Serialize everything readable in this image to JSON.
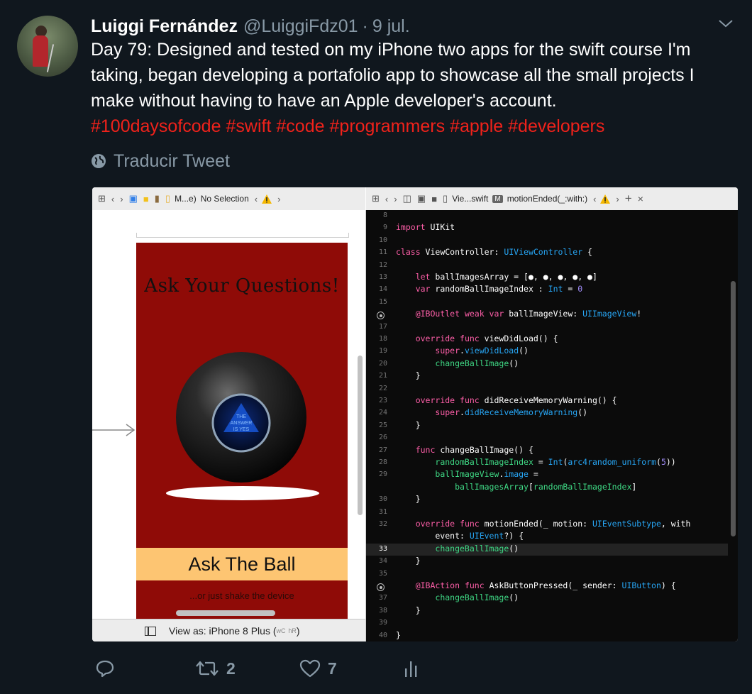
{
  "tweet": {
    "name": "Luiggi Fernández",
    "handle": "@LuiggiFdz01",
    "separator": "·",
    "date": "9 jul.",
    "text": "Day 79: Designed and tested on my iPhone two apps for the swift course I'm taking, began developing a portafolio app to showcase all the small projects I make without having to have an Apple developer's account.",
    "hashtags": [
      "#100daysofcode",
      "#swift",
      "#code",
      "#programmers",
      "#apple",
      "#developers"
    ],
    "translate_label": "Traducir Tweet"
  },
  "xcode": {
    "left_toolbar": {
      "breadcrumb": "M...e)",
      "selection": "No Selection"
    },
    "right_toolbar": {
      "file": "Vie...swift",
      "symbol_badge": "M",
      "method": "motionEnded(_:with:)"
    },
    "bottom_bar": {
      "label": "View as: iPhone 8 Plus (",
      "size_w": "wC",
      "size_h": "hR",
      "label_end": ")"
    },
    "app": {
      "title": "Ask Your Questions!",
      "ball_text": [
        "THE",
        "ANSWER",
        "IS YES"
      ],
      "button": "Ask The Ball",
      "hint": "...or just shake the device"
    },
    "code": [
      {
        "n": "8",
        "t": [
          [
            "",
            ""
          ]
        ]
      },
      {
        "n": "9",
        "t": [
          [
            "kw",
            "import"
          ],
          [
            "",
            " UIKit"
          ]
        ]
      },
      {
        "n": "10",
        "t": [
          [
            "",
            ""
          ]
        ]
      },
      {
        "n": "11",
        "t": [
          [
            "kw",
            "class"
          ],
          [
            "",
            " ViewController: "
          ],
          [
            "ty",
            "UIViewController"
          ],
          [
            "",
            " {"
          ]
        ]
      },
      {
        "n": "12",
        "t": [
          [
            "",
            ""
          ]
        ]
      },
      {
        "n": "13",
        "t": [
          [
            "",
            "    "
          ],
          [
            "kw",
            "let"
          ],
          [
            "",
            " ballImagesArray = [●, ●, ●, ●, ●]"
          ]
        ]
      },
      {
        "n": "14",
        "t": [
          [
            "",
            "    "
          ],
          [
            "kw",
            "var"
          ],
          [
            "",
            " randomBallImageIndex : "
          ],
          [
            "ty",
            "Int"
          ],
          [
            "",
            " = "
          ],
          [
            "num",
            "0"
          ]
        ]
      },
      {
        "n": "15",
        "t": [
          [
            "",
            ""
          ]
        ]
      },
      {
        "n": "",
        "bp": true,
        "t": [
          [
            "",
            "    "
          ],
          [
            "kw",
            "@IBOutlet weak var"
          ],
          [
            "",
            " ballImageView: "
          ],
          [
            "ty",
            "UIImageView"
          ],
          [
            "",
            "!"
          ]
        ]
      },
      {
        "n": "17",
        "t": [
          [
            "",
            ""
          ]
        ]
      },
      {
        "n": "18",
        "t": [
          [
            "",
            "    "
          ],
          [
            "kw",
            "override func"
          ],
          [
            "",
            " viewDidLoad() {"
          ]
        ]
      },
      {
        "n": "19",
        "t": [
          [
            "",
            "        "
          ],
          [
            "kw",
            "super"
          ],
          [
            "",
            "."
          ],
          [
            "ty",
            "viewDidLoad"
          ],
          [
            "",
            "()"
          ]
        ]
      },
      {
        "n": "20",
        "t": [
          [
            "",
            "        "
          ],
          [
            "fn",
            "changeBallImage"
          ],
          [
            "",
            "()"
          ]
        ]
      },
      {
        "n": "21",
        "t": [
          [
            "",
            "    }"
          ]
        ]
      },
      {
        "n": "22",
        "t": [
          [
            "",
            ""
          ]
        ]
      },
      {
        "n": "23",
        "t": [
          [
            "",
            "    "
          ],
          [
            "kw",
            "override func"
          ],
          [
            "",
            " didReceiveMemoryWarning() {"
          ]
        ]
      },
      {
        "n": "24",
        "t": [
          [
            "",
            "        "
          ],
          [
            "kw",
            "super"
          ],
          [
            "",
            "."
          ],
          [
            "ty",
            "didReceiveMemoryWarning"
          ],
          [
            "",
            "()"
          ]
        ]
      },
      {
        "n": "25",
        "t": [
          [
            "",
            "    }"
          ]
        ]
      },
      {
        "n": "26",
        "t": [
          [
            "",
            ""
          ]
        ]
      },
      {
        "n": "27",
        "t": [
          [
            "",
            "    "
          ],
          [
            "kw",
            "func"
          ],
          [
            "",
            " changeBallImage() {"
          ]
        ]
      },
      {
        "n": "28",
        "t": [
          [
            "",
            "        "
          ],
          [
            "fn",
            "randomBallImageIndex"
          ],
          [
            "",
            " = "
          ],
          [
            "ty",
            "Int"
          ],
          [
            "",
            "("
          ],
          [
            "ty",
            "arc4random_uniform"
          ],
          [
            "",
            "("
          ],
          [
            "num",
            "5"
          ],
          [
            "",
            "))"
          ]
        ]
      },
      {
        "n": "29",
        "t": [
          [
            "",
            "        "
          ],
          [
            "fn",
            "ballImageView"
          ],
          [
            "",
            "."
          ],
          [
            "ty",
            "image"
          ],
          [
            "",
            " ="
          ]
        ]
      },
      {
        "n": "",
        "t": [
          [
            "",
            "            "
          ],
          [
            "fn",
            "ballImagesArray"
          ],
          [
            "",
            "["
          ],
          [
            "fn",
            "randomBallImageIndex"
          ],
          [
            "",
            "]"
          ]
        ]
      },
      {
        "n": "30",
        "t": [
          [
            "",
            "    }"
          ]
        ]
      },
      {
        "n": "31",
        "t": [
          [
            "",
            ""
          ]
        ]
      },
      {
        "n": "32",
        "t": [
          [
            "",
            "    "
          ],
          [
            "kw",
            "override func"
          ],
          [
            "",
            " motionEnded(_ motion: "
          ],
          [
            "ty",
            "UIEventSubtype"
          ],
          [
            "",
            ", with"
          ]
        ]
      },
      {
        "n": "",
        "t": [
          [
            "",
            "        event: "
          ],
          [
            "ty",
            "UIEvent"
          ],
          [
            "",
            "?) {"
          ]
        ]
      },
      {
        "n": "33",
        "hl": true,
        "t": [
          [
            "",
            "        "
          ],
          [
            "fn",
            "changeBallImage"
          ],
          [
            "",
            "()"
          ]
        ]
      },
      {
        "n": "34",
        "t": [
          [
            "",
            "    }"
          ]
        ]
      },
      {
        "n": "35",
        "t": [
          [
            "",
            ""
          ]
        ]
      },
      {
        "n": "",
        "bp": true,
        "t": [
          [
            "",
            "    "
          ],
          [
            "kw",
            "@IBAction func"
          ],
          [
            "",
            " AskButtonPressed(_ sender: "
          ],
          [
            "ty",
            "UIButton"
          ],
          [
            "",
            ") {"
          ]
        ]
      },
      {
        "n": "37",
        "t": [
          [
            "",
            "        "
          ],
          [
            "fn",
            "changeBallImage"
          ],
          [
            "",
            "()"
          ]
        ]
      },
      {
        "n": "38",
        "t": [
          [
            "",
            "    }"
          ]
        ]
      },
      {
        "n": "39",
        "t": [
          [
            "",
            ""
          ]
        ]
      },
      {
        "n": "40",
        "t": [
          [
            "",
            "}"
          ]
        ]
      }
    ]
  },
  "actions": {
    "retweets": "2",
    "likes": "7"
  },
  "colors": {
    "background": "#10171e",
    "hashtag": "#f0221b",
    "muted": "#8899a6",
    "app_bg": "#8f0b07",
    "button_bg": "#fdc572"
  }
}
